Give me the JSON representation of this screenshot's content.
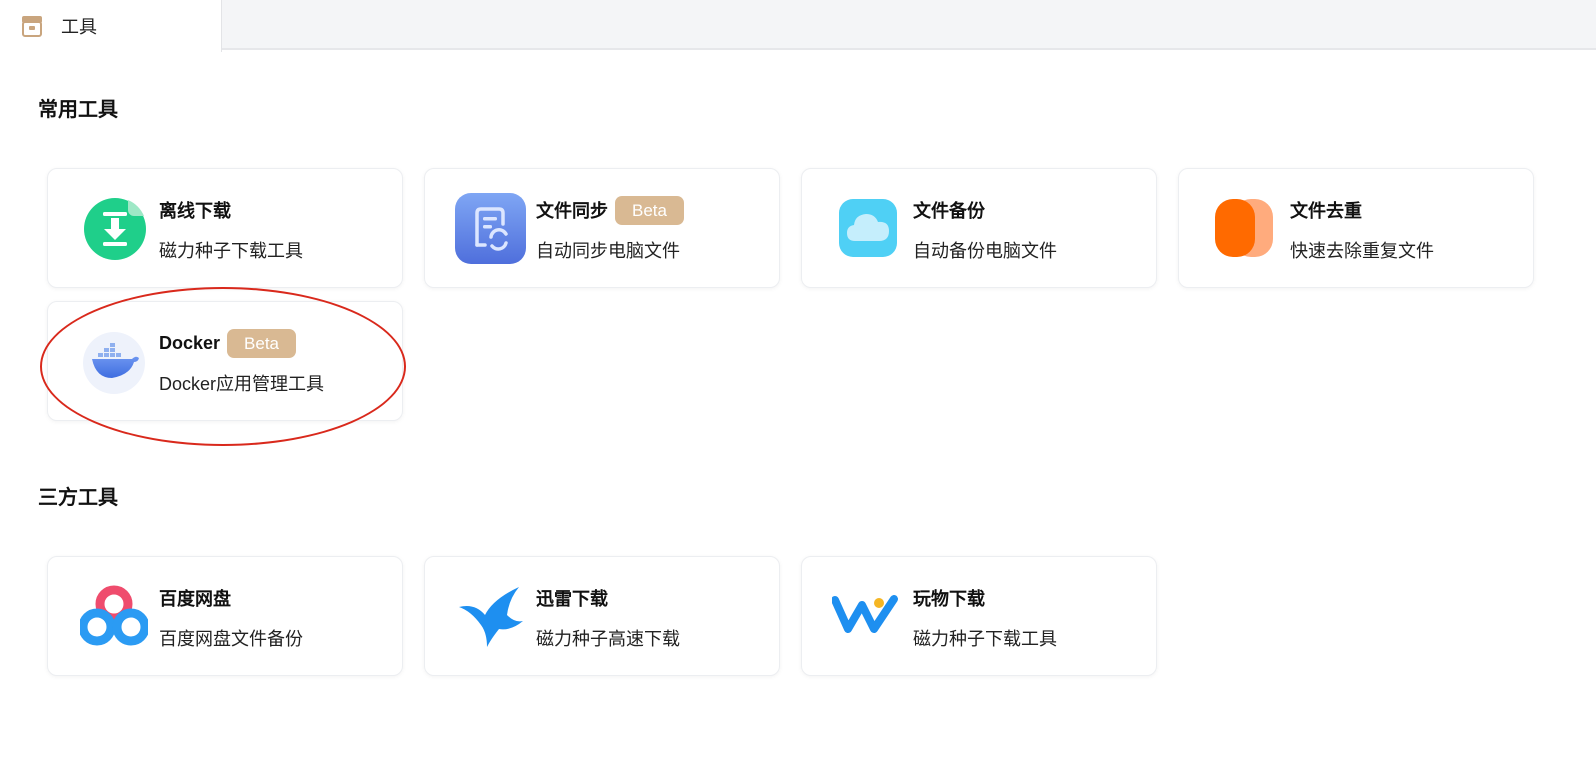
{
  "tab": {
    "label": "工具",
    "icon": "toolbox-icon"
  },
  "sections": {
    "common": {
      "title": "常用工具"
    },
    "third": {
      "title": "三方工具"
    }
  },
  "cards": {
    "offline": {
      "title": "离线下载",
      "desc": "磁力种子下载工具",
      "icon": "download-icon"
    },
    "sync": {
      "title": "文件同步",
      "badge": "Beta",
      "desc": "自动同步电脑文件",
      "icon": "file-sync-icon"
    },
    "backup": {
      "title": "文件备份",
      "desc": "自动备份电脑文件",
      "icon": "cloud-icon"
    },
    "dedup": {
      "title": "文件去重",
      "desc": "快速去除重复文件",
      "icon": "dedup-icon"
    },
    "docker": {
      "title": "Docker",
      "badge": "Beta",
      "desc": "Docker应用管理工具",
      "icon": "docker-icon"
    },
    "baidu": {
      "title": "百度网盘",
      "desc": "百度网盘文件备份",
      "icon": "baidu-netdisk-icon"
    },
    "xunlei": {
      "title": "迅雷下载",
      "desc": "磁力种子高速下载",
      "icon": "xunlei-bird-icon"
    },
    "wanwu": {
      "title": "玩物下载",
      "desc": "磁力种子下载工具",
      "icon": "wanwu-icon"
    }
  },
  "colors": {
    "accent_badge": "#d9b993",
    "highlight_ring": "#d9291c",
    "download_green": "#1fcf8a",
    "sync_blue": "#5b82e6",
    "backup_cyan": "#4fd0f5",
    "dedup_orange": "#ff6a00"
  }
}
